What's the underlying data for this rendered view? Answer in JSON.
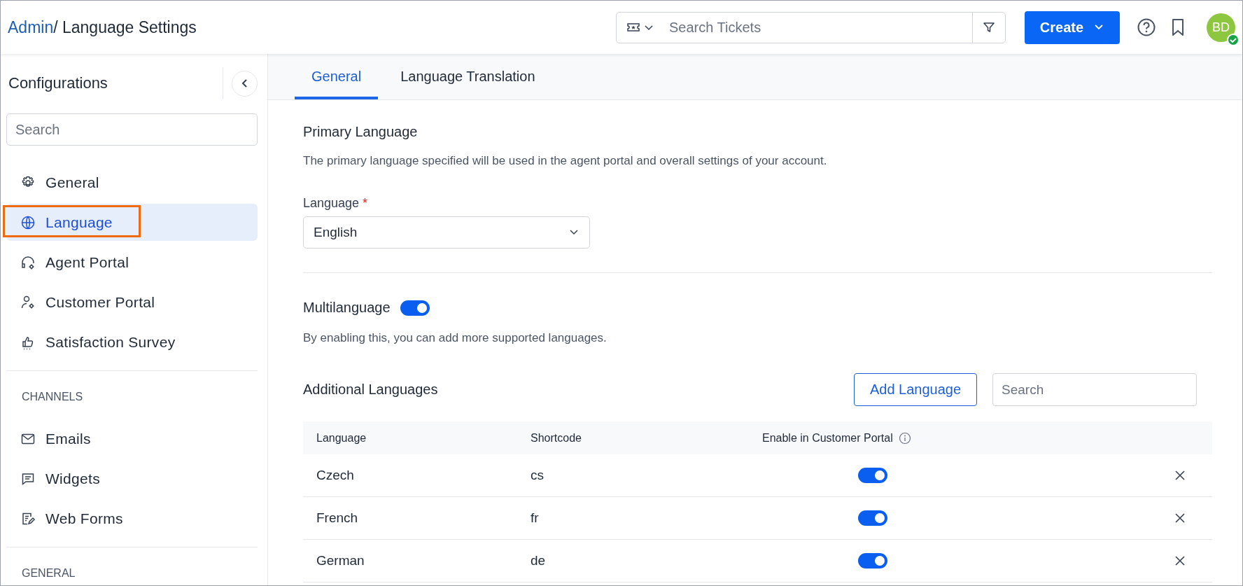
{
  "breadcrumb": {
    "parent": "Admin",
    "current": "/ Language Settings"
  },
  "header": {
    "search_placeholder": "Search Tickets",
    "create_label": "Create",
    "avatar_initials": "BD",
    "avatar_online": true
  },
  "sidebar": {
    "title": "Configurations",
    "search_placeholder": "Search",
    "sections": [
      {
        "items": [
          {
            "label": "General",
            "selected": false
          },
          {
            "label": "Language",
            "selected": true
          },
          {
            "label": "Agent Portal",
            "selected": false
          },
          {
            "label": "Customer Portal",
            "selected": false
          },
          {
            "label": "Satisfaction Survey",
            "selected": false
          }
        ]
      },
      {
        "heading": "CHANNELS",
        "items": [
          {
            "label": "Emails",
            "selected": false
          },
          {
            "label": "Widgets",
            "selected": false
          },
          {
            "label": "Web Forms",
            "selected": false
          }
        ]
      },
      {
        "heading": "GENERAL"
      }
    ]
  },
  "tabs": [
    {
      "label": "General",
      "selected": true
    },
    {
      "label": "Language Translation",
      "selected": false
    }
  ],
  "primary": {
    "title": "Primary Language",
    "description": "The primary language specified will be used in the agent portal and overall settings of your account.",
    "field_label": "Language",
    "required_mark": "*",
    "value": "English"
  },
  "multilanguage": {
    "title": "Multilanguage",
    "on": true,
    "description": "By enabling this, you can add more supported languages."
  },
  "additional": {
    "title": "Additional Languages",
    "add_button": "Add Language",
    "search_placeholder": "Search",
    "columns": [
      "Language",
      "Shortcode",
      "Enable in Customer Portal"
    ],
    "rows": [
      {
        "language": "Czech",
        "shortcode": "cs",
        "enabled": true
      },
      {
        "language": "French",
        "shortcode": "fr",
        "enabled": true
      },
      {
        "language": "German",
        "shortcode": "de",
        "enabled": true
      }
    ]
  }
}
